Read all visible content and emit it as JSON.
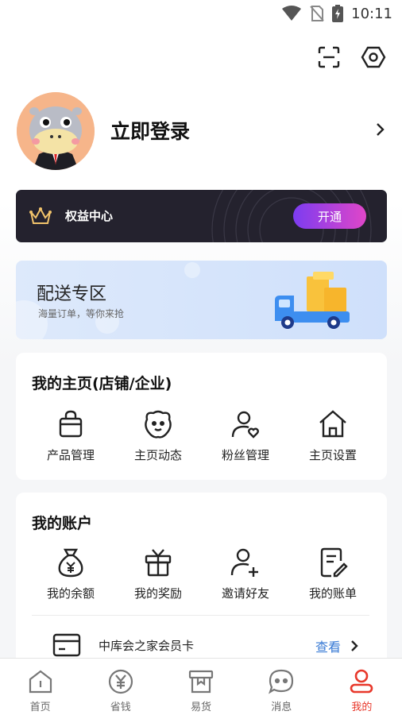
{
  "status_bar": {
    "time": "10:11",
    "icons": [
      "signal-icon",
      "no-sim-icon",
      "battery-charging-icon"
    ]
  },
  "header": {
    "icons": [
      "scan-icon",
      "settings-icon"
    ]
  },
  "profile": {
    "login_text": "立即登录",
    "avatar_icon": "hippo-avatar-icon"
  },
  "vip": {
    "label": "权益中心",
    "button": "开通"
  },
  "delivery": {
    "title": "配送专区",
    "subtitle": "海量订单，等你来抢"
  },
  "homepage_card": {
    "title": "我的主页(店铺/企业)",
    "items": [
      {
        "label": "产品管理",
        "icon": "shopping-bag-icon"
      },
      {
        "label": "主页动态",
        "icon": "face-icon"
      },
      {
        "label": "粉丝管理",
        "icon": "user-heart-icon"
      },
      {
        "label": "主页设置",
        "icon": "home-icon"
      }
    ]
  },
  "account_card": {
    "title": "我的账户",
    "items": [
      {
        "label": "我的余额",
        "icon": "money-bag-icon"
      },
      {
        "label": "我的奖励",
        "icon": "gift-icon"
      },
      {
        "label": "邀请好友",
        "icon": "add-user-icon"
      },
      {
        "label": "我的账单",
        "icon": "bill-icon"
      }
    ],
    "member": {
      "label": "中库会之家会员卡",
      "action": "查看"
    }
  },
  "tabs": [
    {
      "label": "首页",
      "icon": "home-tab-icon",
      "active": false
    },
    {
      "label": "省钱",
      "icon": "yen-coin-icon",
      "active": false
    },
    {
      "label": "易货",
      "icon": "box-icon",
      "active": false
    },
    {
      "label": "消息",
      "icon": "chat-icon",
      "active": false
    },
    {
      "label": "我的",
      "icon": "profile-tab-icon",
      "active": true
    }
  ],
  "colors": {
    "accent": "#e8382b",
    "link": "#3a7bd5",
    "vip_bg": "#24222e"
  }
}
